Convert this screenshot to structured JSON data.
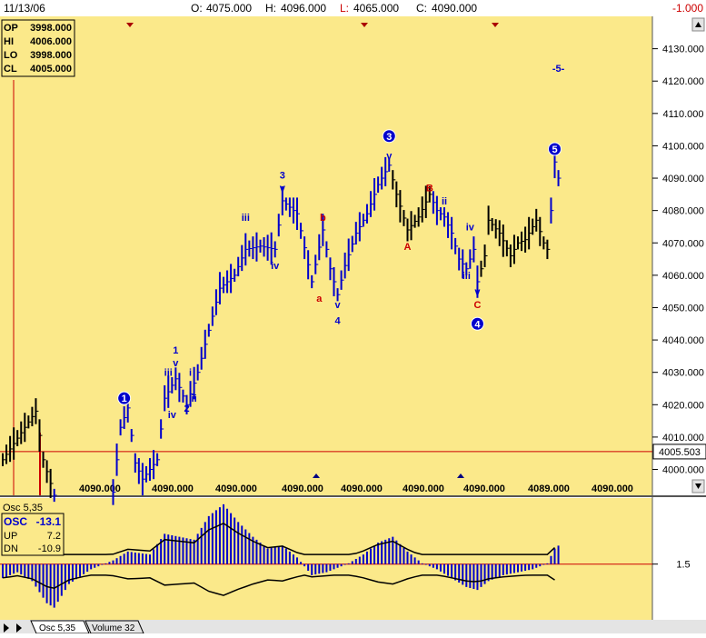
{
  "header": {
    "date": "11/13/06",
    "open_label": "O:",
    "open": "4075.000",
    "high_label": "H:",
    "high": "4096.000",
    "low_label": "L:",
    "low": "4065.000",
    "close_label": "C:",
    "close": "4090.000",
    "change": "-1.000"
  },
  "info_box": [
    {
      "label": "OP",
      "value": "3998.000"
    },
    {
      "label": "HI",
      "value": "4006.000"
    },
    {
      "label": "LO",
      "value": "3998.000"
    },
    {
      "label": "CL",
      "value": "4005.000"
    }
  ],
  "price_axis": {
    "ticks": [
      "4130.000",
      "4120.000",
      "4110.000",
      "4100.000",
      "4090.000",
      "4080.000",
      "4070.000",
      "4060.000",
      "4050.000",
      "4040.000",
      "4030.000",
      "4020.000",
      "4010.000",
      "4000.000"
    ],
    "tick_values": [
      4130,
      4120,
      4110,
      4100,
      4090,
      4080,
      4070,
      4060,
      4050,
      4040,
      4030,
      4020,
      4010,
      4000
    ],
    "current_price": "4005.503",
    "current_value": 4005.503
  },
  "bottom_labels": [
    "4090.000",
    "4090.000",
    "4090.000",
    "4090.000",
    "4090.000",
    "4090.000",
    "4090.000",
    "4089.000",
    "4090.000"
  ],
  "osc": {
    "title": "Osc 5,35",
    "legend": [
      {
        "label": "OSC",
        "value": "-13.1"
      },
      {
        "label": "UP",
        "value": "7.2"
      },
      {
        "label": "DN",
        "value": "-10.9"
      }
    ],
    "axis_value": "1.5",
    "axis_numeric": 1.5
  },
  "tabs": [
    "Osc 5,35",
    "Volume 32"
  ],
  "colors": {
    "background": "#fbe98a",
    "bar": "#0000cc",
    "bar_alt": "#000000",
    "wave_blue": "#0000cc",
    "wave_red": "#cc0000",
    "guide_line": "#cc0000"
  },
  "chart_data": {
    "type": "bar",
    "ylim": [
      3992,
      4140
    ],
    "wave_labels": [
      {
        "text": "1",
        "circled": true,
        "color": "blue",
        "bar": 33,
        "price": 4022
      },
      {
        "text": "i",
        "color": "blue",
        "bar": 40,
        "price": 4000
      },
      {
        "text": "iii",
        "color": "blue",
        "bar": 45,
        "price": 4030
      },
      {
        "text": "iv",
        "color": "blue",
        "bar": 46,
        "price": 4017
      },
      {
        "text": "1",
        "color": "blue",
        "bar": 47,
        "price": 4037
      },
      {
        "text": "v",
        "color": "blue",
        "bar": 47,
        "price": 4033
      },
      {
        "text": "2",
        "color": "blue",
        "bar": 50,
        "price": 4019
      },
      {
        "text": "i",
        "color": "blue",
        "bar": 51,
        "price": 4030
      },
      {
        "text": "ii",
        "color": "blue",
        "bar": 52,
        "price": 4022
      },
      {
        "text": "iii",
        "color": "blue",
        "bar": 66,
        "price": 4078
      },
      {
        "text": "iv",
        "color": "blue",
        "bar": 74,
        "price": 4063
      },
      {
        "text": "3",
        "color": "blue",
        "bar": 76,
        "price": 4091
      },
      {
        "text": "v",
        "color": "blue",
        "bar": 76,
        "price": 4087
      },
      {
        "text": "b",
        "color": "red",
        "bar": 87,
        "price": 4078
      },
      {
        "text": "a",
        "color": "red",
        "bar": 86,
        "price": 4053
      },
      {
        "text": "v",
        "color": "blue",
        "bar": 91,
        "price": 4051
      },
      {
        "text": "4",
        "color": "blue",
        "bar": 91,
        "price": 4046
      },
      {
        "text": "3",
        "circled": true,
        "color": "blue",
        "bar": 105,
        "price": 4103
      },
      {
        "text": "v",
        "color": "blue",
        "bar": 105,
        "price": 4097
      },
      {
        "text": "A",
        "color": "red",
        "bar": 110,
        "price": 4069
      },
      {
        "text": "B",
        "color": "red",
        "bar": 116,
        "price": 4087
      },
      {
        "text": "ii",
        "color": "blue",
        "bar": 120,
        "price": 4083
      },
      {
        "text": "iv",
        "color": "blue",
        "bar": 127,
        "price": 4075
      },
      {
        "text": "iii",
        "color": "blue",
        "bar": 126,
        "price": 4060
      },
      {
        "text": "v",
        "color": "blue",
        "bar": 129,
        "price": 4055
      },
      {
        "text": "C",
        "color": "red",
        "bar": 129,
        "price": 4051
      },
      {
        "text": "4",
        "circled": true,
        "color": "blue",
        "bar": 129,
        "price": 4045
      },
      {
        "text": "5",
        "circled": true,
        "color": "blue",
        "bar": 150,
        "price": 4099
      },
      {
        "text": "-5-",
        "color": "blue",
        "bar": 151,
        "price": 4124
      }
    ]
  }
}
